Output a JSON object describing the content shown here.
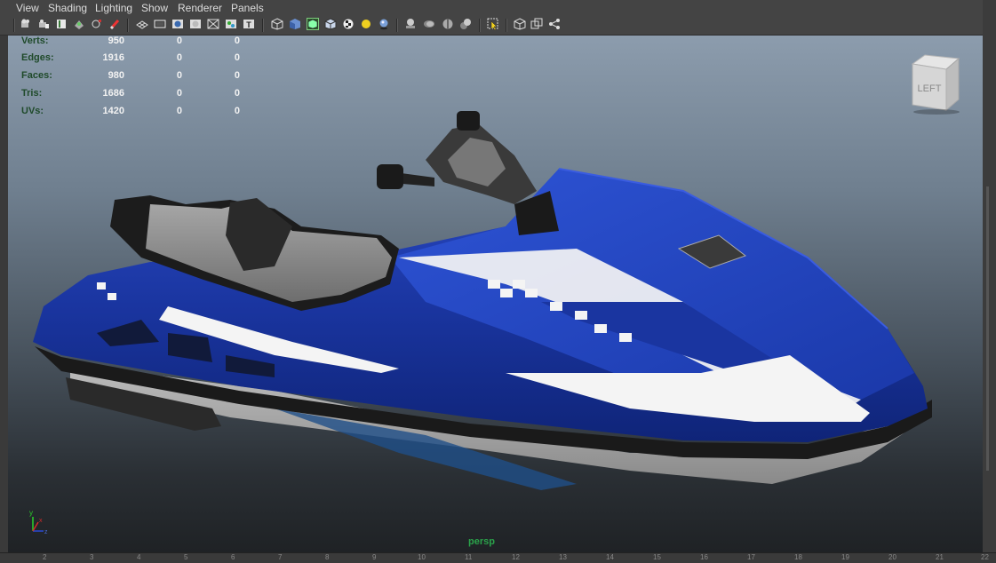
{
  "menu": {
    "items": [
      "View",
      "Shading",
      "Lighting",
      "Show",
      "Renderer",
      "Panels"
    ]
  },
  "toolbar": {
    "icons": [
      "select-camera-icon",
      "camera-attributes-icon",
      "bookmark-icon",
      "image-plane-icon",
      "2d-pan-zoom-icon",
      "grease-pencil-icon",
      "grid-icon",
      "film-gate-icon",
      "resolution-gate-icon",
      "gate-mask-icon",
      "field-chart-icon",
      "safe-action-icon",
      "safe-title-icon",
      "wireframe-icon",
      "smooth-shade-icon",
      "wireframe-on-shaded-icon",
      "bounding-box-icon",
      "textured-icon",
      "use-all-lights-icon",
      "shadows-icon",
      "screen-space-ao-icon",
      "motion-blur-icon",
      "multisample-aa-icon",
      "depth-of-field-icon",
      "isolate-select-icon",
      "xray-icon",
      "xray-joints-icon",
      "xray-components-icon"
    ]
  },
  "hud": {
    "rows": [
      {
        "label": "Verts:",
        "v1": "950",
        "v2": "0",
        "v3": "0"
      },
      {
        "label": "Edges:",
        "v1": "1916",
        "v2": "0",
        "v3": "0"
      },
      {
        "label": "Faces:",
        "v1": "980",
        "v2": "0",
        "v3": "0"
      },
      {
        "label": "Tris:",
        "v1": "1686",
        "v2": "0",
        "v3": "0"
      },
      {
        "label": "UVs:",
        "v1": "1420",
        "v2": "0",
        "v3": "0"
      }
    ]
  },
  "viewcube": {
    "face_label": "LEFT"
  },
  "axis": {
    "x": "x",
    "y": "y",
    "z": "z"
  },
  "camera_label": "persp",
  "ruler": {
    "numbers": [
      "2",
      "3",
      "4",
      "5",
      "6",
      "7",
      "8",
      "9",
      "10",
      "11",
      "12",
      "13",
      "14",
      "15",
      "16",
      "17",
      "18",
      "19",
      "20",
      "21",
      "22"
    ]
  },
  "colors": {
    "hull_blue": "#1a3aa8",
    "stripe_white": "#f4f4f4",
    "seat_grey": "#8a8a8a",
    "hud_label": "#1f4a2a",
    "camera_label": "#2aa24a"
  }
}
